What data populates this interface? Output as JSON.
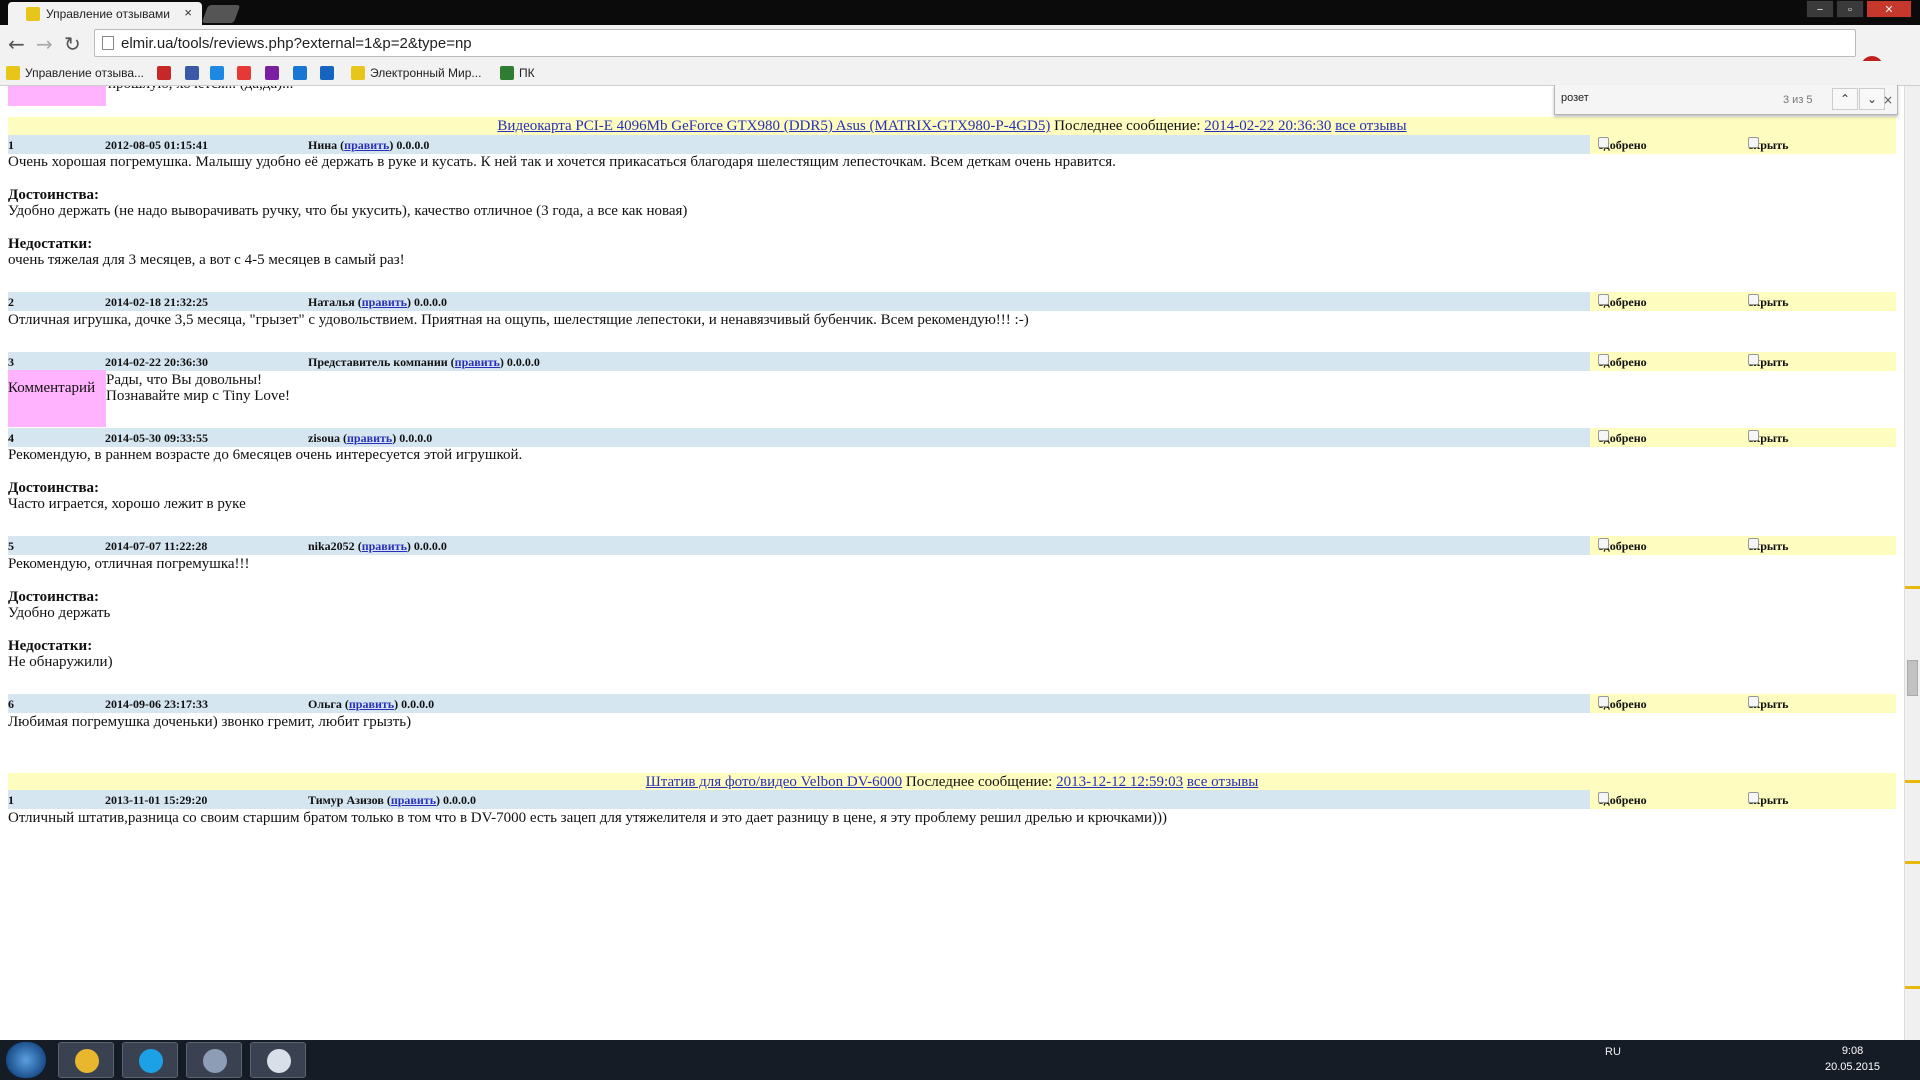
{
  "browser": {
    "tab_title": "Управление отзывами",
    "tab_close": "×",
    "url": "elmir.ua/tools/reviews.php?external=1&p=2&type=np",
    "window_buttons": [
      "−",
      "▫",
      "✕"
    ],
    "abp_label": "ABP",
    "bookmarks": [
      {
        "label": "Управление отзыва...",
        "color": "#e8c619"
      },
      {
        "label": "",
        "color": "#c62828"
      },
      {
        "label": "",
        "color": "#3b5aa6"
      },
      {
        "label": "",
        "color": "#1e88e5"
      },
      {
        "label": "",
        "color": "#e53935"
      },
      {
        "label": "",
        "color": "#7b1fa2"
      },
      {
        "label": "",
        "color": "#1976d2"
      },
      {
        "label": "",
        "color": "#1565c0"
      },
      {
        "label": "Электронный Мир...",
        "color": "#e8c619"
      },
      {
        "label": "ПК",
        "color": "#2e7d32"
      }
    ]
  },
  "findbar": {
    "query": "розет",
    "count": "3 из 5",
    "up": "⌃",
    "down": "⌄",
    "close": "×"
  },
  "labels": {
    "approved": "одобрено",
    "hide": "скрыть",
    "edit": "править",
    "last_message": "Последнее сообщение:",
    "all_reviews": "все отзывы",
    "comment": "Комментарий",
    "pros": "Достоинства:",
    "cons": "Недостатки:",
    "ip": "0.0.0.0"
  },
  "products": [
    {
      "name": "Видеокарта PCI-E 4096Mb GeForce GTX980 (DDR5) Asus (MATRIX-GTX980-P-4GD5)",
      "last_date": "2014-02-22 20:36:30",
      "reviews": [
        {
          "n": "1",
          "date": "2012-08-05 01:15:41",
          "author": "Нина",
          "text": "Очень хорошая погремушка. Малышу удобно её держать в руке и кусать. К ней так и хочется прикасаться благодаря шелестящим лепесточкам. Всем деткам очень нравится.",
          "pros": "Удобно держать (не надо выворачивать ручку, что бы укусить), качество отличное (3 года, а все как новая)",
          "cons": "очень тяжелая для 3 месяцев, а вот с 4-5 месяцев в самый раз!"
        },
        {
          "n": "2",
          "date": "2014-02-18 21:32:25",
          "author": "Наталья",
          "text": "Отличная игрушка, дочке 3,5 месяца, \"грызет\" с удовольствием. Приятная на ощупь, шелестящие лепестоки, и ненавязчивый бубенчик. Всем рекомендую!!! :-)"
        },
        {
          "n": "3",
          "date": "2014-02-22 20:36:30",
          "author": "Представитель компании",
          "comment_line1": "Рады, что Вы довольны!",
          "comment_line2": "Познавайте мир с Tiny Love!"
        },
        {
          "n": "4",
          "date": "2014-05-30 09:33:55",
          "author": "zisoua",
          "text": "Рекомендую, в раннем возрасте до 6месяцев очень интересуется этой игрушкой.",
          "pros": "Часто играется, хорошо лежит в руке"
        },
        {
          "n": "5",
          "date": "2014-07-07 11:22:28",
          "author": "nika2052",
          "text": "Рекомендую, отличная погремушка!!!",
          "pros": "Удобно держать",
          "cons": "Не обнаружили)"
        },
        {
          "n": "6",
          "date": "2014-09-06 23:17:33",
          "author": "Ольга",
          "text": "Любимая погремушка доченьки) звонко гремит, любит грызть)"
        }
      ]
    },
    {
      "name": "Штатив для фото/видео Velbon DV-6000",
      "last_date": "2013-12-12 12:59:03",
      "reviews": [
        {
          "n": "1",
          "date": "2013-11-01 15:29:20",
          "author": "Тимур Азизов",
          "text": "Отличный штатив,разница со своим старшим братом только в том что в  DV-7000  есть зацеп для утяжелителя и это дает разницу в цене, я эту проблему решил дрелью и крючками)))"
        }
      ]
    }
  ],
  "top_partial_text": "прошлую, хочется... (да,да)...",
  "taskbar": {
    "lang": "RU",
    "time": "9:08",
    "date": "20.05.2015",
    "apps": [
      {
        "name": "chrome",
        "color": "#e8b72e"
      },
      {
        "name": "skype",
        "color": "#1da1e6"
      },
      {
        "name": "calculator",
        "color": "#8d9db5"
      },
      {
        "name": "paint",
        "color": "#d9dfe8"
      }
    ]
  }
}
